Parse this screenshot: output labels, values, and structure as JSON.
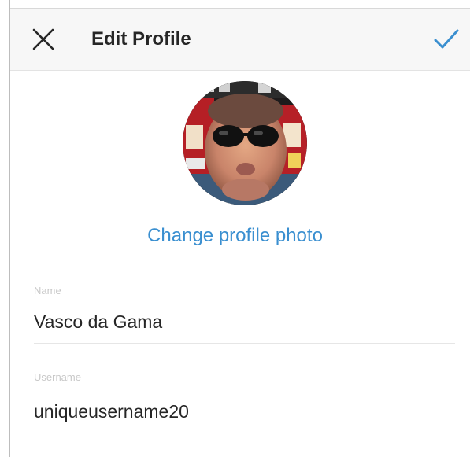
{
  "header": {
    "title": "Edit Profile",
    "close_icon": "close-icon",
    "done_icon": "checkmark-icon"
  },
  "profile_photo": {
    "change_label": "Change profile photo"
  },
  "form": {
    "name": {
      "label": "Name",
      "value": "Vasco da Gama"
    },
    "username": {
      "label": "Username",
      "value": "uniqueusername20"
    }
  },
  "colors": {
    "accent": "#3a8fd0",
    "text": "#262626",
    "label": "#c8c8c8",
    "header_bg": "#f7f7f7"
  }
}
